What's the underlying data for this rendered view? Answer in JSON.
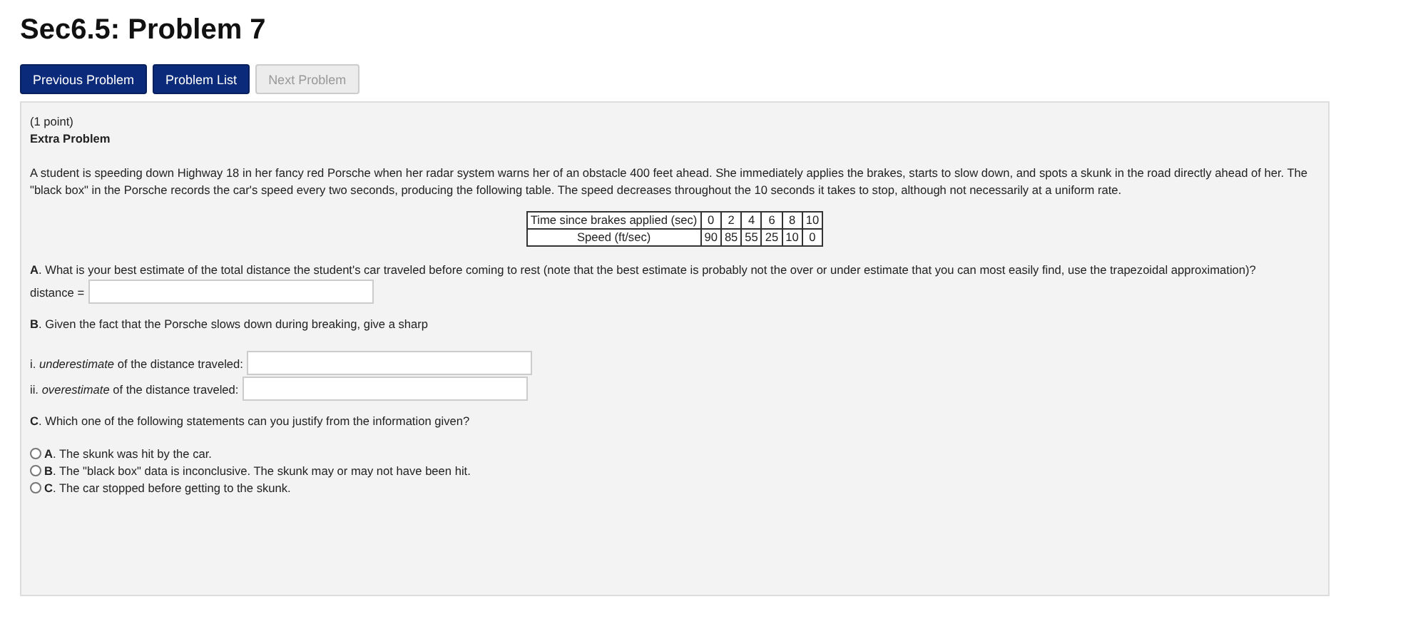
{
  "title": "Sec6.5: Problem 7",
  "nav_buttons": [
    {
      "label": "Previous Problem",
      "disabled": false
    },
    {
      "label": "Problem List",
      "disabled": false
    },
    {
      "label": "Next Problem",
      "disabled": true
    }
  ],
  "problem": {
    "points": "(1 point)",
    "heading": "Extra Problem",
    "intro": "A student is speeding down Highway 18 in her fancy red Porsche when her radar system warns her of an obstacle 400 feet ahead. She immediately applies the brakes, starts to slow down, and spots a skunk in the road directly ahead of her. The \"black box\" in the Porsche records the car's speed every two seconds, producing the following table. The speed decreases throughout the 10 seconds it takes to stop, although not necessarily at a uniform rate.",
    "table": {
      "rows": [
        [
          "Time since brakes applied (sec)",
          "0",
          "2",
          "4",
          "6",
          "8",
          "10"
        ],
        [
          "Speed (ft/sec)",
          "90",
          "85",
          "55",
          "25",
          "10",
          "0"
        ]
      ]
    },
    "part_a": {
      "question": "**A**. What is your best estimate of the total distance the student's car traveled before coming to rest (note that the best estimate is probably not the over or under estimate that you can most easily find, use the trapezoidal approximation)?",
      "label": "distance ="
    },
    "part_b": {
      "question": "**B**. Given the fact that the Porsche slows down during breaking, give a sharp",
      "fields": [
        {
          "label": "i. *underestimate* of the distance traveled:"
        },
        {
          "label": "ii. *overestimate* of the distance traveled:"
        }
      ]
    },
    "part_c": {
      "question": "**C**. Which one of the following statements can you justify from the information given?",
      "options": [
        {
          "label": "**A**. The skunk was hit by the car.",
          "selected": false
        },
        {
          "label": "**B**. The \"black box\" data is inconclusive. The skunk may or may not have been hit.",
          "selected": false
        },
        {
          "label": "**C**. The car stopped before getting to the skunk.",
          "selected": false
        }
      ]
    }
  }
}
